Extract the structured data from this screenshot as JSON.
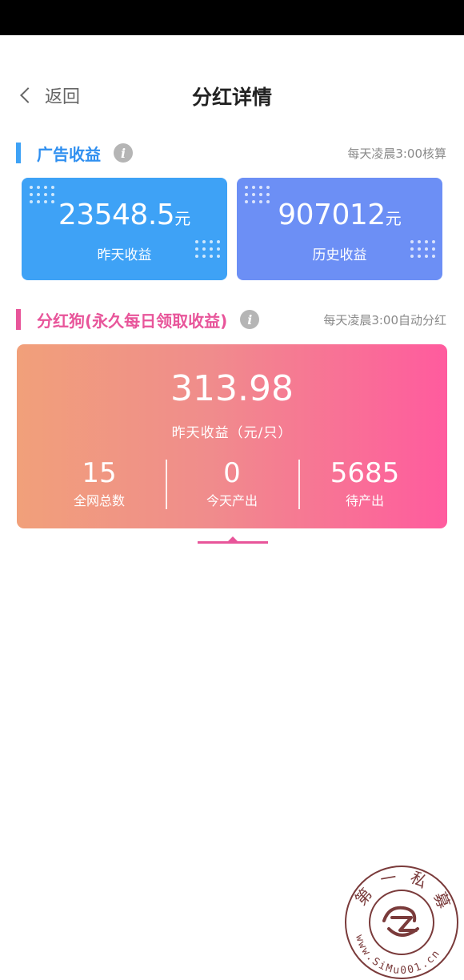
{
  "nav": {
    "back_label": "返回",
    "title": "分红详情"
  },
  "ad_section": {
    "title": "广告收益",
    "note": "每天凌晨3:00核算",
    "accent": "#3ea2f6",
    "cards": [
      {
        "value": "23548.5",
        "unit": "元",
        "label": "昨天收益",
        "color": "#3ea2f6"
      },
      {
        "value": "907012",
        "unit": "元",
        "label": "历史收益",
        "color": "#6c8ff5"
      }
    ]
  },
  "dividend_section": {
    "title": "分红狗(永久每日领取收益)",
    "note": "每天凌晨3:00自动分红",
    "accent": "#e8559a",
    "main_value": "313.98",
    "main_label": "昨天收益（元/只）",
    "stats": [
      {
        "value": "15",
        "label": "全网总数"
      },
      {
        "value": "0",
        "label": "今天产出"
      },
      {
        "value": "5685",
        "label": "待产出"
      }
    ]
  },
  "watermark": {
    "top_text": "第一私募",
    "bottom_text": "www.SiMu001.cn"
  },
  "icons": {
    "back": "chevron-left-icon",
    "info": "info-icon"
  }
}
